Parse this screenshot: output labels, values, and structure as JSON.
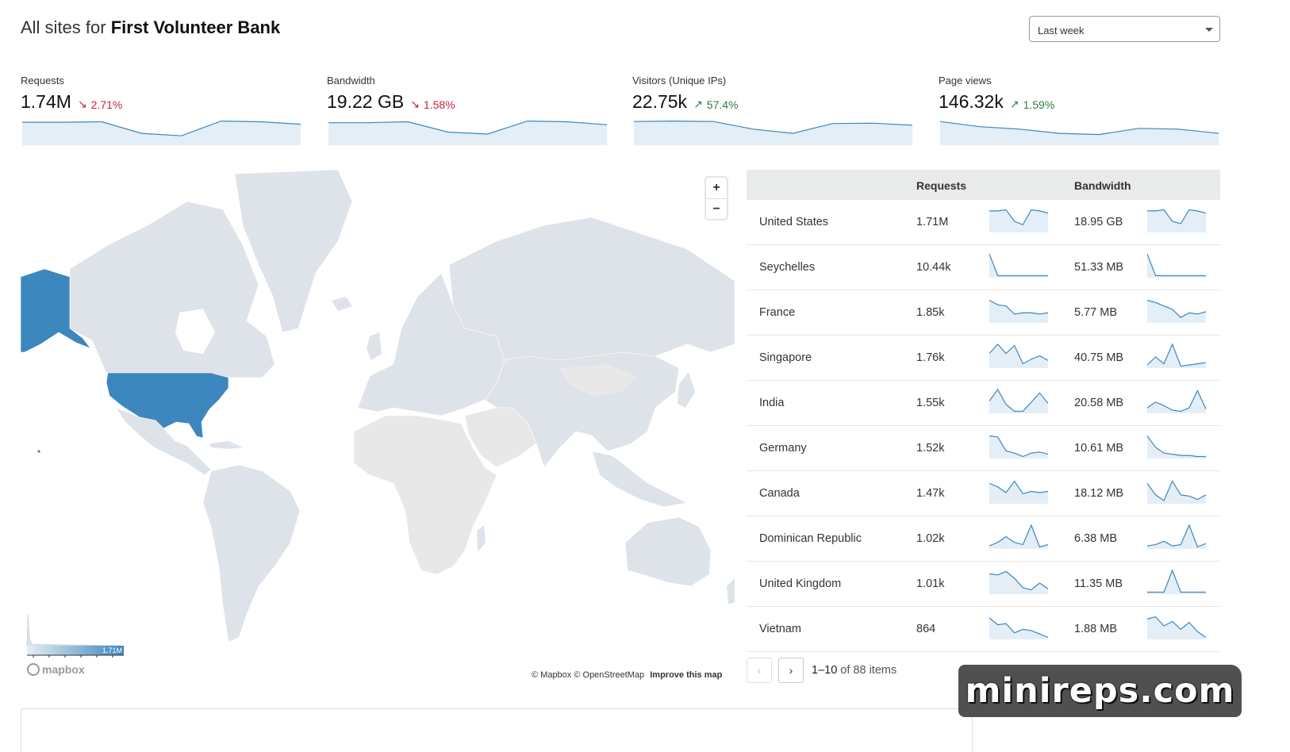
{
  "header": {
    "title_prefix": "All sites for ",
    "title_account": "First Volunteer Bank",
    "range_select": "Last week"
  },
  "metrics": [
    {
      "label": "Requests",
      "value": "1.74M",
      "change": "2.71%",
      "direction": "down",
      "trend": [
        0.9,
        0.9,
        0.92,
        0.45,
        0.35,
        0.95,
        0.92,
        0.82
      ]
    },
    {
      "label": "Bandwidth",
      "value": "19.22 GB",
      "change": "1.58%",
      "direction": "down",
      "trend": [
        0.88,
        0.88,
        0.92,
        0.5,
        0.42,
        0.95,
        0.92,
        0.8
      ]
    },
    {
      "label": "Visitors (Unique IPs)",
      "value": "22.75k",
      "change": "57.4%",
      "direction": "up",
      "trend": [
        0.93,
        0.95,
        0.93,
        0.62,
        0.45,
        0.85,
        0.86,
        0.78
      ]
    },
    {
      "label": "Page views",
      "value": "146.32k",
      "change": "1.59%",
      "direction": "up",
      "trend": [
        0.93,
        0.72,
        0.62,
        0.45,
        0.4,
        0.65,
        0.62,
        0.45
      ]
    }
  ],
  "map": {
    "zoom_in": "+",
    "zoom_out": "−",
    "legend_max": "1.71M",
    "logo": "mapbox",
    "attribution": "© Mapbox © OpenStreetMap",
    "improve_link": "Improve this map",
    "colors": {
      "highlight": "#3c87be",
      "land": "#dde3e8",
      "land_alt": "#e8e8e8"
    }
  },
  "table": {
    "headers": {
      "requests": "Requests",
      "bandwidth": "Bandwidth"
    },
    "rows": [
      {
        "country": "United States",
        "requests": "1.71M",
        "bandwidth": "18.95 GB",
        "req_trend": [
          0.9,
          0.9,
          0.95,
          0.45,
          0.3,
          0.95,
          0.9,
          0.8
        ],
        "bw_trend": [
          0.9,
          0.9,
          0.95,
          0.45,
          0.35,
          0.95,
          0.9,
          0.8
        ]
      },
      {
        "country": "Seychelles",
        "requests": "10.44k",
        "bandwidth": "51.33 MB",
        "req_trend": [
          1.0,
          0.05,
          0.05,
          0.05,
          0.05,
          0.05,
          0.05,
          0.05
        ],
        "bw_trend": [
          1.0,
          0.05,
          0.05,
          0.05,
          0.05,
          0.05,
          0.05,
          0.05
        ]
      },
      {
        "country": "France",
        "requests": "1.85k",
        "bandwidth": "5.77 MB",
        "req_trend": [
          0.95,
          0.75,
          0.7,
          0.35,
          0.4,
          0.4,
          0.35,
          0.4
        ],
        "bw_trend": [
          0.95,
          0.85,
          0.7,
          0.55,
          0.2,
          0.4,
          0.35,
          0.45
        ]
      },
      {
        "country": "Singapore",
        "requests": "1.76k",
        "bandwidth": "40.75 MB",
        "req_trend": [
          0.6,
          1.0,
          0.6,
          0.95,
          0.15,
          0.35,
          0.5,
          0.3
        ],
        "bw_trend": [
          0.1,
          0.45,
          0.15,
          1.0,
          0.05,
          0.1,
          0.15,
          0.2
        ]
      },
      {
        "country": "India",
        "requests": "1.55k",
        "bandwidth": "20.58 MB",
        "req_trend": [
          0.5,
          1.0,
          0.35,
          0.05,
          0.05,
          0.45,
          0.85,
          0.4
        ],
        "bw_trend": [
          0.2,
          0.45,
          0.3,
          0.1,
          0.05,
          0.2,
          0.95,
          0.15
        ]
      },
      {
        "country": "Germany",
        "requests": "1.52k",
        "bandwidth": "10.61 MB",
        "req_trend": [
          0.95,
          0.9,
          0.3,
          0.2,
          0.05,
          0.2,
          0.25,
          0.15
        ],
        "bw_trend": [
          0.95,
          0.45,
          0.2,
          0.15,
          0.1,
          0.1,
          0.05,
          0.05
        ]
      },
      {
        "country": "Canada",
        "requests": "1.47k",
        "bandwidth": "18.12 MB",
        "req_trend": [
          0.85,
          0.7,
          0.45,
          0.95,
          0.4,
          0.5,
          0.45,
          0.5
        ],
        "bw_trend": [
          0.85,
          0.35,
          0.1,
          0.95,
          0.35,
          0.3,
          0.15,
          0.35
        ]
      },
      {
        "country": "Dominican Republic",
        "requests": "1.02k",
        "bandwidth": "6.38 MB",
        "req_trend": [
          0.1,
          0.25,
          0.5,
          0.25,
          0.15,
          1.0,
          0.05,
          0.15
        ],
        "bw_trend": [
          0.1,
          0.15,
          0.3,
          0.1,
          0.15,
          1.0,
          0.05,
          0.2
        ]
      },
      {
        "country": "United Kingdom",
        "requests": "1.01k",
        "bandwidth": "11.35 MB",
        "req_trend": [
          0.85,
          0.8,
          0.95,
          0.65,
          0.25,
          0.15,
          0.45,
          0.2
        ],
        "bw_trend": [
          0.05,
          0.05,
          0.05,
          1.0,
          0.05,
          0.05,
          0.05,
          0.05
        ]
      },
      {
        "country": "Vietnam",
        "requests": "864",
        "bandwidth": "1.88 MB",
        "req_trend": [
          0.9,
          0.6,
          0.65,
          0.25,
          0.4,
          0.35,
          0.2,
          0.05
        ],
        "bw_trend": [
          0.85,
          0.95,
          0.55,
          0.75,
          0.4,
          0.7,
          0.3,
          0.05
        ]
      }
    ]
  },
  "pagination": {
    "prev_icon": "chevron-left",
    "next_icon": "chevron-right",
    "range": "1–10",
    "of_label": "of 88 items"
  },
  "watermark": "minireps.com"
}
